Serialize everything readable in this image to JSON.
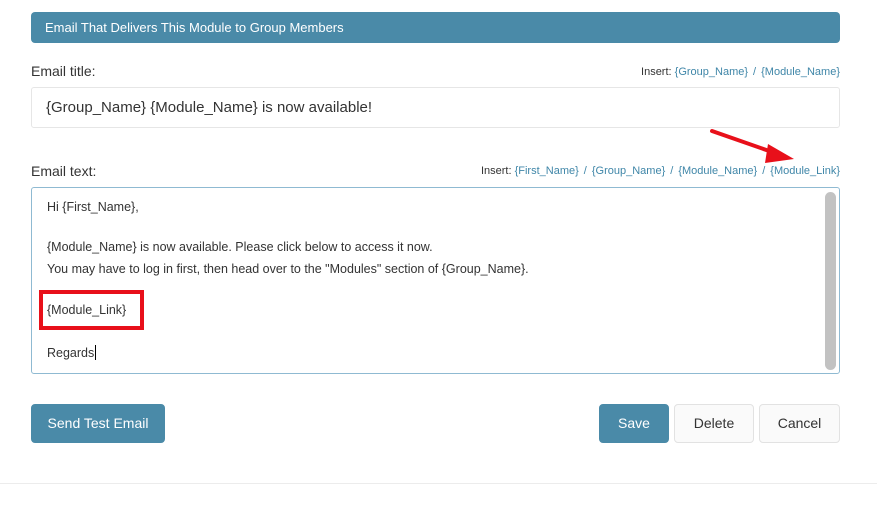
{
  "header": {
    "title": "Email That Delivers This Module to Group Members"
  },
  "email_title": {
    "label": "Email title:",
    "insert_label": "Insert:",
    "insert_tokens": [
      "{Group_Name}",
      "{Module_Name}"
    ],
    "value": "{Group_Name} {Module_Name} is now available!"
  },
  "email_text": {
    "label": "Email text:",
    "insert_label": "Insert:",
    "insert_tokens": [
      "{First_Name}",
      "{Group_Name}",
      "{Module_Name}",
      "{Module_Link}"
    ],
    "separator": "/",
    "lines": [
      "Hi {First_Name},",
      "{Module_Name} is now available. Please click below to access it now.",
      "You may have to log in first, then head over to the \"Modules\" section of {Group_Name}.",
      "{Module_Link}",
      "Regards"
    ]
  },
  "buttons": {
    "send_test": "Send Test Email",
    "save": "Save",
    "delete": "Delete",
    "cancel": "Cancel"
  },
  "annotation": {
    "highlight_color": "#e8101a",
    "arrow_color": "#e8101a"
  },
  "colors": {
    "accent": "#4a8aa8",
    "link": "#3f86a8"
  }
}
